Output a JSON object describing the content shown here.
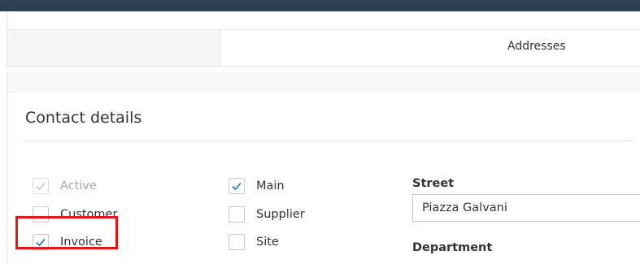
{
  "tabs": {
    "addresses_label": "Addresses"
  },
  "section": {
    "title": "Contact details"
  },
  "checkboxes": {
    "active": {
      "label": "Active",
      "checked": true,
      "disabled": true
    },
    "customer": {
      "label": "Customer",
      "checked": false
    },
    "invoice": {
      "label": "Invoice",
      "checked": true
    },
    "main": {
      "label": "Main",
      "checked": true
    },
    "supplier": {
      "label": "Supplier",
      "checked": false
    },
    "site": {
      "label": "Site",
      "checked": false
    }
  },
  "fields": {
    "street_label": "Street",
    "street_value": "Piazza Galvani",
    "department_label": "Department"
  },
  "colors": {
    "highlight": "#e5151a",
    "check": "#2a6fbd",
    "topbar": "#2f3f52"
  }
}
